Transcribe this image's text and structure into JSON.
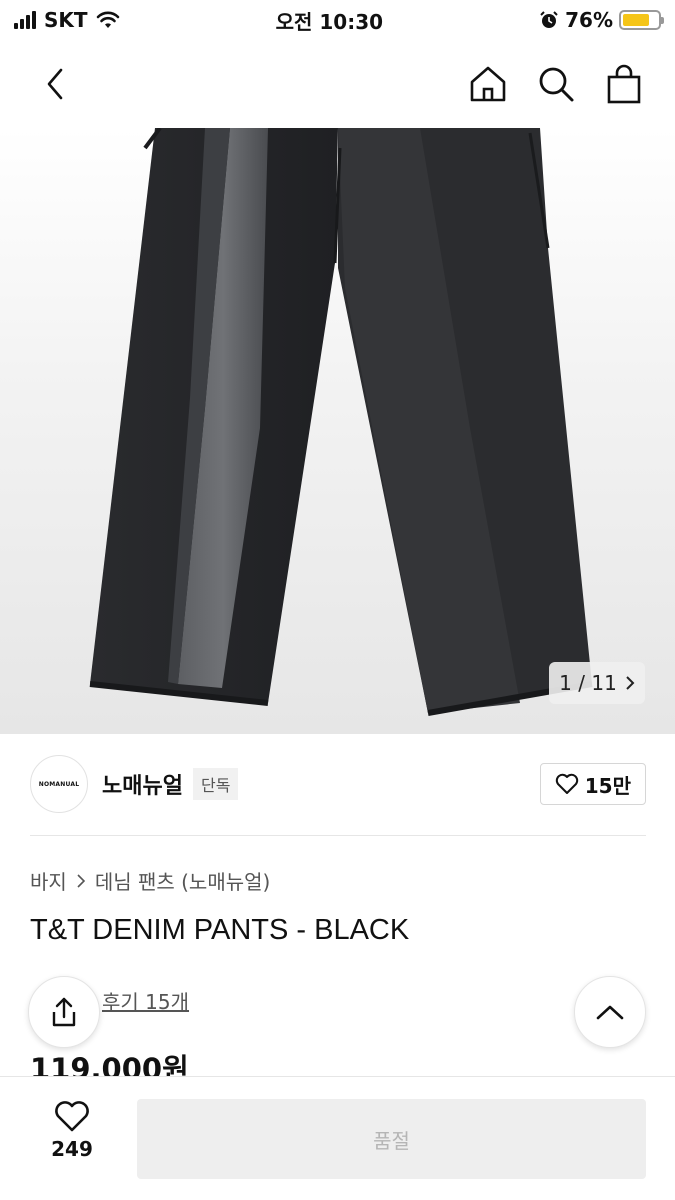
{
  "status_bar": {
    "carrier": "SKT",
    "time": "오전 10:30",
    "battery": "76%",
    "battery_level": 0.76
  },
  "gallery": {
    "current": "1",
    "separator": "/",
    "total": "11"
  },
  "brand": {
    "logo_text": "NOMANUAL",
    "name": "노매뉴얼",
    "badge": "단독",
    "likes": "15만"
  },
  "breadcrumb": {
    "category": "바지",
    "subcategory": "데님 팬츠 (노매뉴얼)"
  },
  "product": {
    "title": "T&T DENIM PANTS - BLACK",
    "reviews": "후기 15개",
    "price": "119,000원"
  },
  "bottom_bar": {
    "wish_count": "249",
    "buy_label": "품절"
  },
  "colors": {
    "battery": "#f5c518",
    "disabled_button": "#eeeeee"
  },
  "icons": [
    "back-arrow-icon",
    "home-icon",
    "search-icon",
    "shopping-bag-icon",
    "chevron-right-icon",
    "heart-icon",
    "share-icon",
    "chevron-up-icon",
    "wifi-icon",
    "alarm-icon"
  ]
}
